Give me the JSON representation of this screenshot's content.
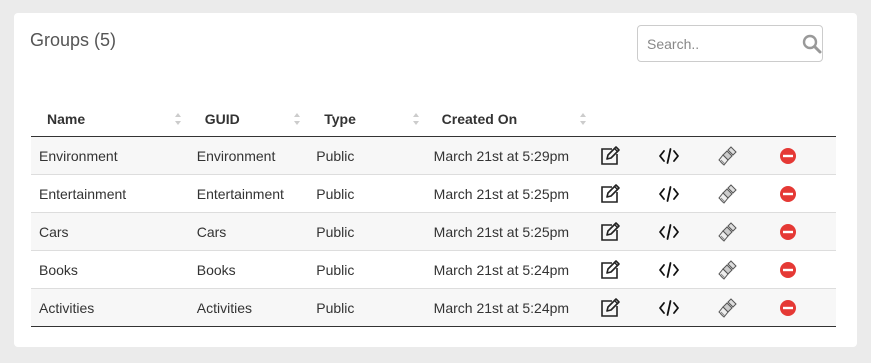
{
  "header": {
    "title": "Groups (5)"
  },
  "search": {
    "placeholder": "Search.."
  },
  "table": {
    "columns": [
      "Name",
      "GUID",
      "Type",
      "Created On"
    ],
    "rows": [
      {
        "name": "Environment",
        "guid": "Environment",
        "type": "Public",
        "created": "March 21st at 5:29pm"
      },
      {
        "name": "Entertainment",
        "guid": "Entertainment",
        "type": "Public",
        "created": "March 21st at 5:25pm"
      },
      {
        "name": "Cars",
        "guid": "Cars",
        "type": "Public",
        "created": "March 21st at 5:25pm"
      },
      {
        "name": "Books",
        "guid": "Books",
        "type": "Public",
        "created": "March 21st at 5:24pm"
      },
      {
        "name": "Activities",
        "guid": "Activities",
        "type": "Public",
        "created": "March 21st at 5:24pm"
      }
    ],
    "row_actions": [
      "edit-icon",
      "code-icon",
      "brush-icon",
      "remove-icon"
    ]
  },
  "colors": {
    "remove": "#e53935",
    "background": "#ebebeb",
    "stripe": "#f7f7f7"
  }
}
